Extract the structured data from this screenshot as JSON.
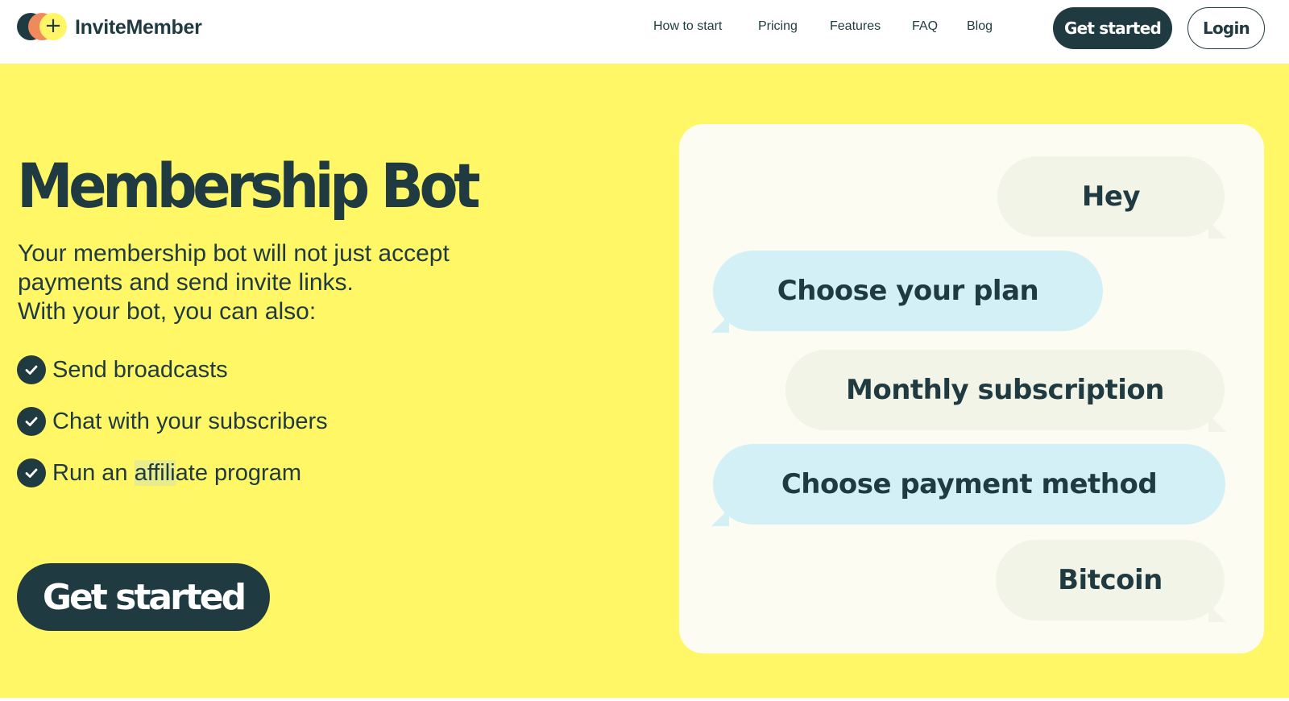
{
  "header": {
    "brand": "InviteMember",
    "nav": [
      "How to start",
      "Pricing",
      "Features",
      "FAQ",
      "Blog"
    ],
    "cta_label": "Get started",
    "login_label": "Login"
  },
  "hero": {
    "title": "Membership Bot",
    "intro_lines": [
      "Your membership bot will not just accept",
      "payments and send invite links.",
      "With your bot, you can also:"
    ],
    "features": [
      {
        "text": "Send broadcasts"
      },
      {
        "text": "Chat with your subscribers"
      },
      {
        "pre": "Run an ",
        "highlight": "affili",
        "post": "ate program"
      }
    ],
    "cta_label": "Get started"
  },
  "chat": {
    "messages": [
      {
        "text": "Hey",
        "from": "user"
      },
      {
        "text": "Choose your plan",
        "from": "bot"
      },
      {
        "text": "Monthly subscription",
        "from": "user"
      },
      {
        "text": "Choose payment method",
        "from": "bot"
      },
      {
        "text": "Bitcoin",
        "from": "user"
      }
    ]
  },
  "colors": {
    "accent_dark": "#1f3a40",
    "hero_background": "#fff766",
    "bot_bubble": "#d3f0f6",
    "user_bubble": "#f2f4e8"
  }
}
